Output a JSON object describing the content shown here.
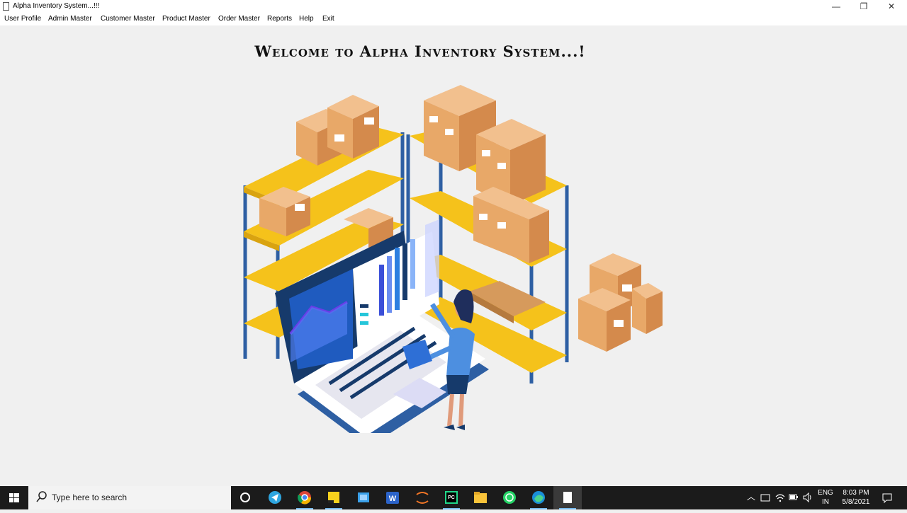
{
  "window": {
    "title": "Alpha Inventory System...!!!",
    "minimize_glyph": "—",
    "maximize_glyph": "❐",
    "close_glyph": "✕"
  },
  "menu": {
    "items": [
      "User Profile",
      "Admin Master",
      "Customer Master",
      "Product Master",
      "Order Master",
      "Reports",
      "Help",
      "Exit"
    ]
  },
  "main": {
    "welcome": "Welcome to Alpha Inventory System...!"
  },
  "taskbar": {
    "search_placeholder": "Type here to search",
    "apps": [
      "cortana-icon",
      "telegram-icon",
      "chrome-icon",
      "sticky-notes-icon",
      "app-icon",
      "word-icon",
      "jupyter-icon",
      "pycharm-icon",
      "file-explorer-icon",
      "whatsapp-icon",
      "edge-icon",
      "document-icon"
    ],
    "language": "ENG",
    "region": "IN",
    "time": "8:03 PM",
    "date": "5/8/2021"
  },
  "colors": {
    "shelf_yellow": "#f5c21b",
    "shelf_blue": "#2e5fa3",
    "box_tan": "#e8a868",
    "screen_navy": "#163a6b",
    "accent_purple": "#6a3de8"
  }
}
